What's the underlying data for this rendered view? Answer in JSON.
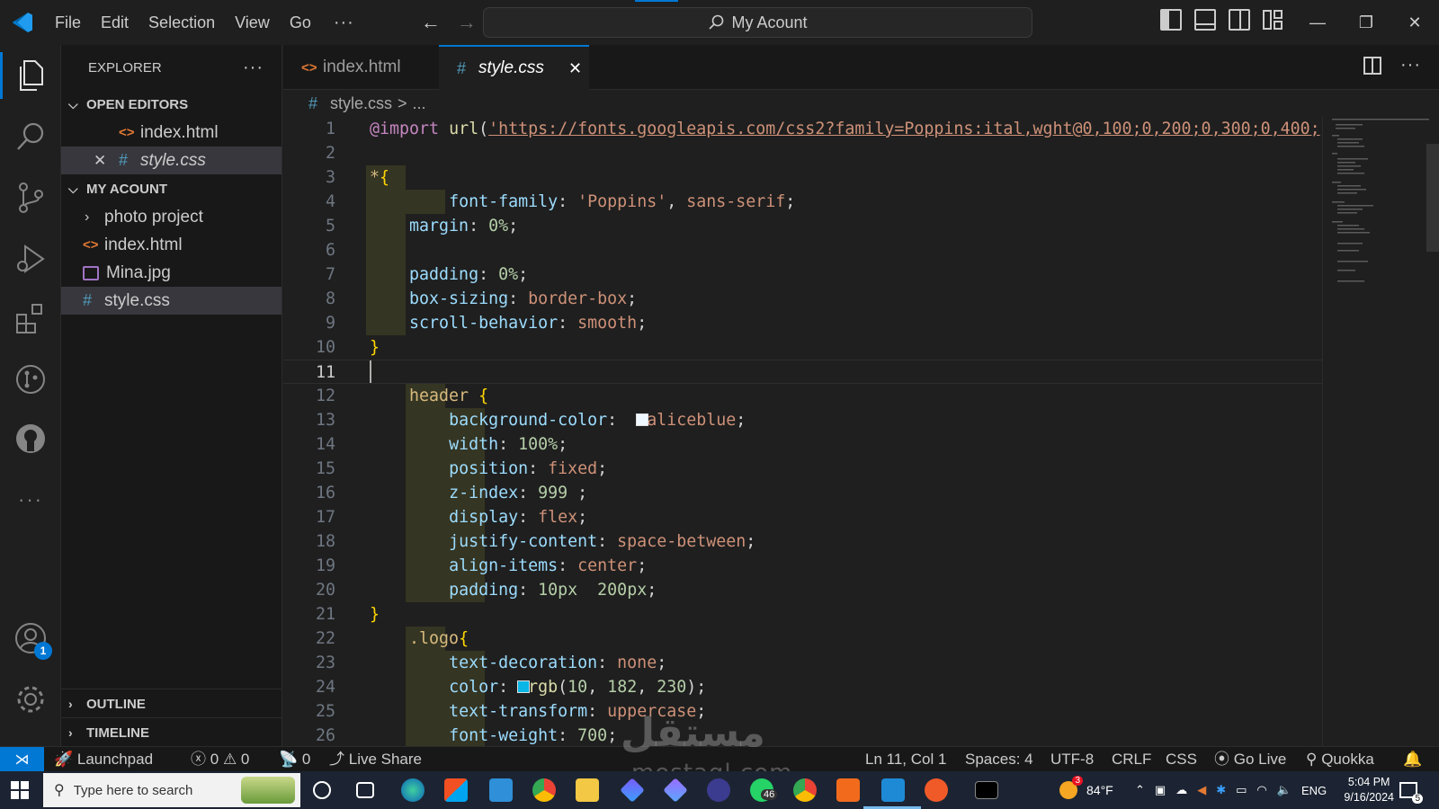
{
  "titlebar": {
    "menu": [
      "File",
      "Edit",
      "Selection",
      "View",
      "Go"
    ],
    "more": "···",
    "command_center": "My Acount",
    "win_minimize": "—",
    "win_restore": "❐",
    "win_close": "✕"
  },
  "sidebar": {
    "title": "EXPLORER",
    "more": "···",
    "open_editors_label": "OPEN EDITORS",
    "open_editors": [
      {
        "name": "index.html",
        "icon": "<>"
      },
      {
        "name": "style.css",
        "icon": "#",
        "close": "✕"
      }
    ],
    "folder_label": "MY ACOUNT",
    "files": [
      {
        "name": "photo project"
      },
      {
        "name": "index.html",
        "icon": "<>"
      },
      {
        "name": "Mina.jpg"
      },
      {
        "name": "style.css",
        "icon": "#"
      }
    ],
    "outline_label": "OUTLINE",
    "timeline_label": "TIMELINE"
  },
  "activity": {
    "accounts_badge": "1"
  },
  "tabs": [
    {
      "label": "index.html",
      "icon": "<>"
    },
    {
      "label": "style.css",
      "icon": "#",
      "close": "✕"
    }
  ],
  "breadcrumb": {
    "icon": "#",
    "file": "style.css",
    "sep": ">",
    "rest": "..."
  },
  "editor": {
    "lines": [
      "@import url('https://fonts.googleapis.com/css2?family=Poppins:ital,wght@0,100;0,200;0,300;0,400;",
      "",
      "*{",
      "        font-family: 'Poppins', sans-serif;",
      "    margin: 0%;",
      "",
      "    padding: 0%;",
      "    box-sizing: border-box;",
      "    scroll-behavior: smooth;",
      "}",
      "",
      "    header {",
      "        background-color:   aliceblue;",
      "        width: 100%;",
      "        position: fixed;",
      "        z-index: 999 ;",
      "        display: flex;",
      "        justify-content: space-between;",
      "        align-items: center;",
      "        padding: 10px  200px;",
      "}",
      "    .logo{",
      "        text-decoration: none;",
      "        color:  rgb(10, 182, 230);",
      "        text-transform: uppercase;",
      "        font-weight: 700;"
    ],
    "line_numbers": [
      "1",
      "2",
      "3",
      "4",
      "5",
      "6",
      "7",
      "8",
      "9",
      "10",
      "11",
      "12",
      "13",
      "14",
      "15",
      "16",
      "17",
      "18",
      "19",
      "20",
      "21",
      "22",
      "23",
      "24",
      "25",
      "26"
    ]
  },
  "statusbar": {
    "launchpad": "Launchpad",
    "errors": "0",
    "warnings": "0",
    "ports": "0",
    "live_share": "Live Share",
    "position": "Ln 11, Col 1",
    "spaces": "Spaces: 4",
    "encoding": "UTF-8",
    "eol": "CRLF",
    "language": "CSS",
    "go_live": "Go Live",
    "quokka": "Quokka"
  },
  "taskbar": {
    "search_placeholder": "Type here to search",
    "whatsapp_badge": "46",
    "weather_badge": "3",
    "temperature": "84°F",
    "lang": "ENG",
    "time": "5:04 PM",
    "date": "9/16/2024",
    "notif_count": "5"
  },
  "watermark": {
    "arabic": "مستقل",
    "latin": "mostaql.com"
  },
  "colors": {
    "accent": "#0078d4",
    "editor_bg": "#1f1f1f",
    "sidebar_bg": "#181818",
    "keyword": "#c586c0",
    "property": "#9cdcfe",
    "string": "#ce9178",
    "number": "#b5cea8",
    "selector": "#d7ba7d",
    "brace": "#ffd700"
  }
}
